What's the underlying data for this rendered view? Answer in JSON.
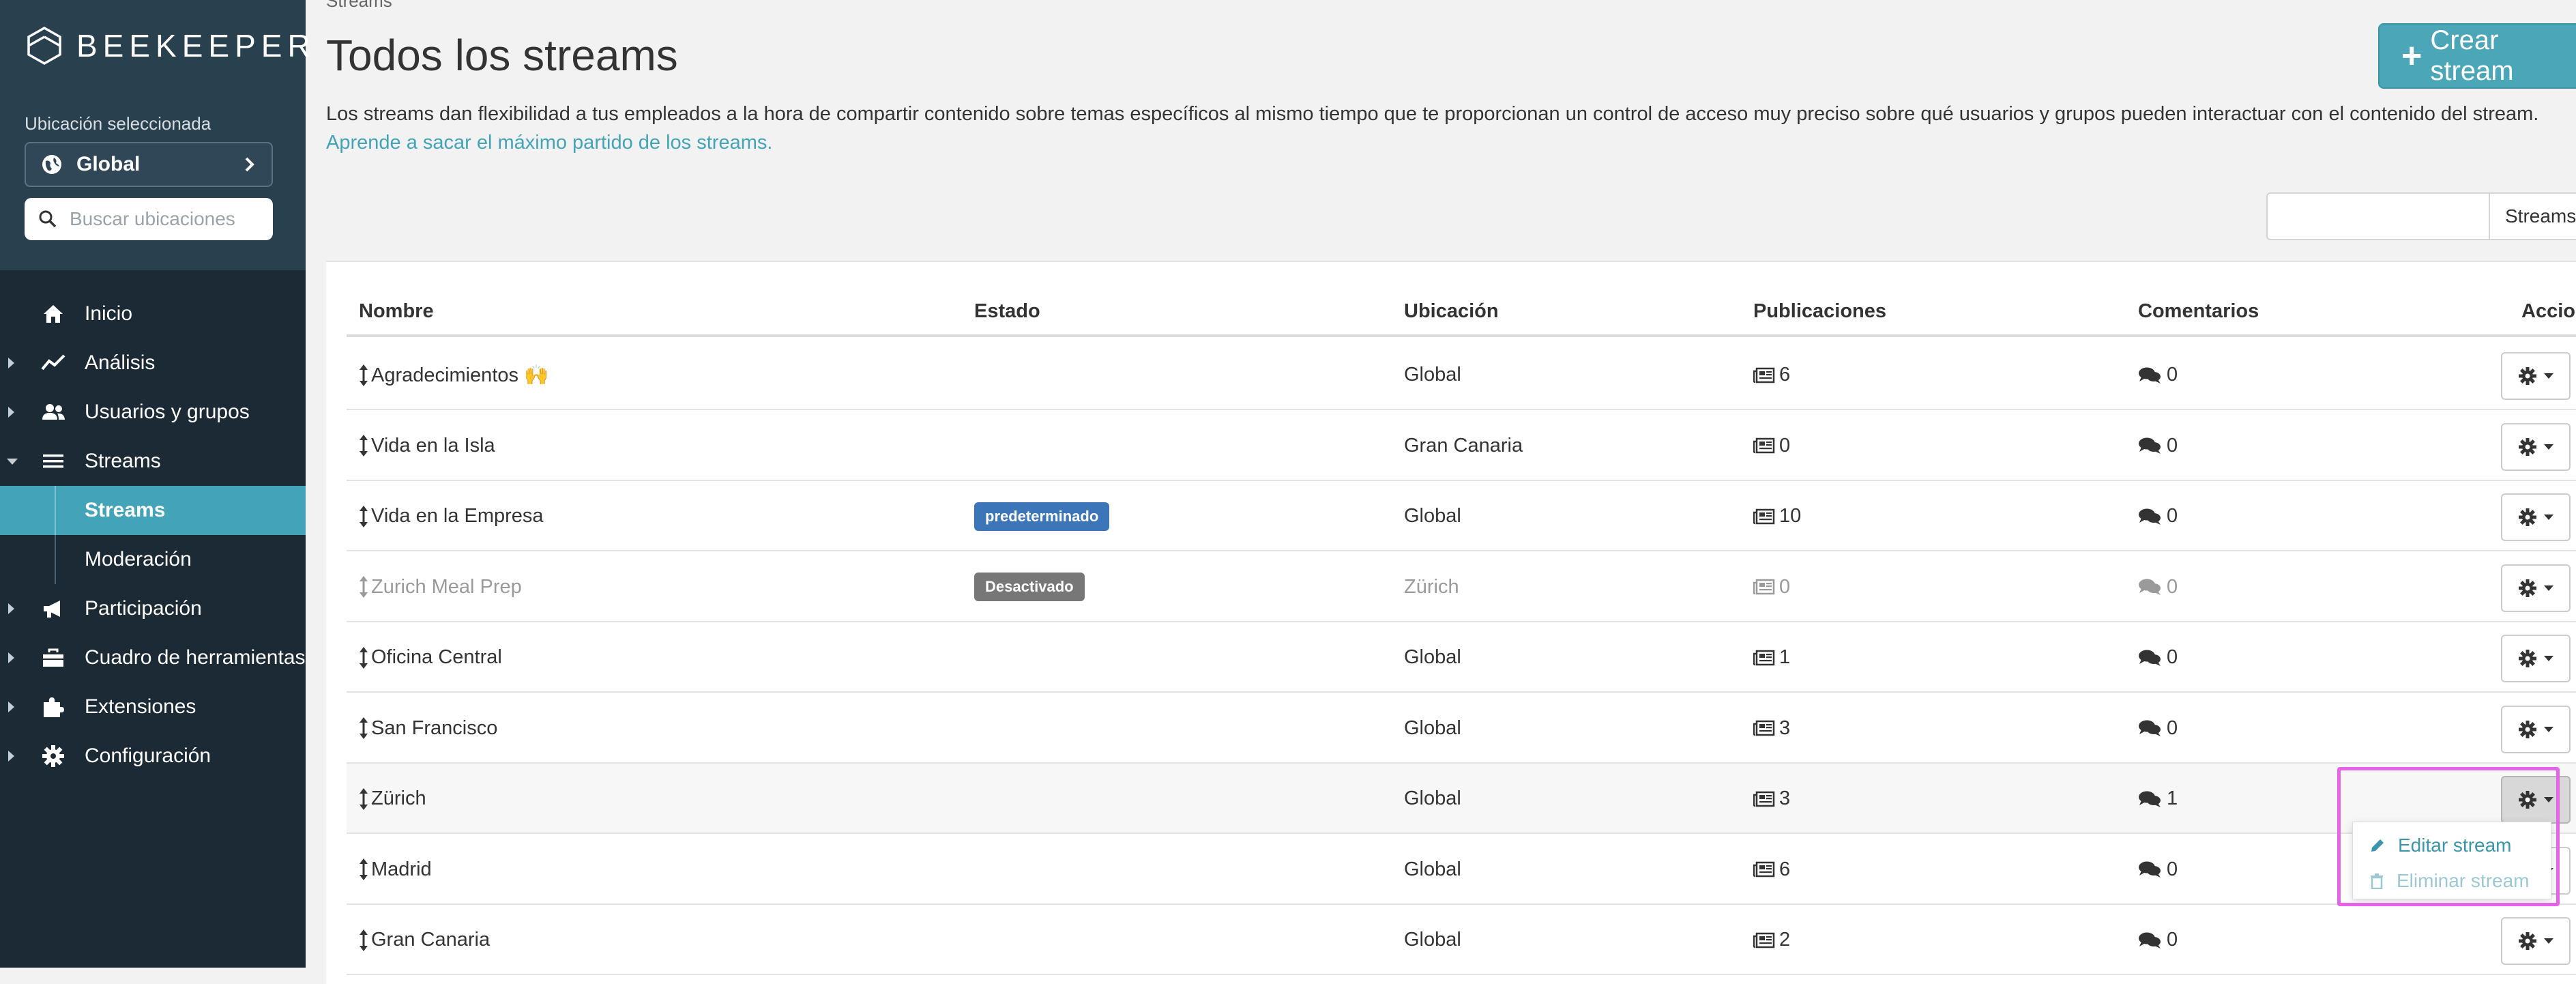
{
  "brand": {
    "name": "BEEKEEPER"
  },
  "location": {
    "label": "Ubicación seleccionada",
    "selected": "Global",
    "search_placeholder": "Buscar ubicaciones"
  },
  "nav": {
    "inicio": "Inicio",
    "analisis": "Análisis",
    "usuarios": "Usuarios y grupos",
    "streams": "Streams",
    "streams_sub": "Streams",
    "moderacion": "Moderación",
    "participacion": "Participación",
    "herramientas": "Cuadro de herramientas",
    "extensiones": "Extensiones",
    "configuracion": "Configuración"
  },
  "header": {
    "breadcrumb": "Streams",
    "title": "Todos los streams",
    "create_button": "Crear stream",
    "intro_text": "Los streams dan flexibilidad a tus empleados a la hora de compartir contenido sobre temas específicos al mismo tiempo que te proporcionan un control de acceso muy preciso sobre qué usuarios y grupos pueden interactuar con el contenido del stream. ",
    "intro_link": "Aprende a sacar el máximo partido de los streams."
  },
  "filter": {
    "input_value": "",
    "select_value": "Streams"
  },
  "table": {
    "headers": {
      "name": "Nombre",
      "state": "Estado",
      "location": "Ubicación",
      "posts": "Publicaciones",
      "comments": "Comentarios",
      "actions": "Acciones"
    },
    "rows": [
      {
        "name": "Agradecimientos 🙌",
        "state": "",
        "location": "Global",
        "posts": "6",
        "comments": "0"
      },
      {
        "name": "Vida en la Isla",
        "state": "",
        "location": "Gran Canaria",
        "posts": "0",
        "comments": "0"
      },
      {
        "name": "Vida en la Empresa",
        "state": "predeterminado",
        "location": "Global",
        "posts": "10",
        "comments": "0"
      },
      {
        "name": "Zurich Meal Prep",
        "state": "Desactivado",
        "location": "Zürich",
        "posts": "0",
        "comments": "0"
      },
      {
        "name": "Oficina Central",
        "state": "",
        "location": "Global",
        "posts": "1",
        "comments": "0"
      },
      {
        "name": "San Francisco",
        "state": "",
        "location": "Global",
        "posts": "3",
        "comments": "0"
      },
      {
        "name": "Zürich",
        "state": "",
        "location": "Global",
        "posts": "3",
        "comments": "1"
      },
      {
        "name": "Madrid",
        "state": "",
        "location": "Global",
        "posts": "6",
        "comments": "0"
      },
      {
        "name": "Gran Canaria",
        "state": "",
        "location": "Global",
        "posts": "2",
        "comments": "0"
      }
    ]
  },
  "dropdown": {
    "edit": "Editar stream",
    "delete": "Eliminar stream"
  },
  "colors": {
    "sidebar": "#1b2a35",
    "sidebar_top": "#29404f",
    "accent": "#43a3b8",
    "badge_default": "#3d76b8",
    "badge_disabled": "#777777",
    "highlight": "#e563e8"
  }
}
